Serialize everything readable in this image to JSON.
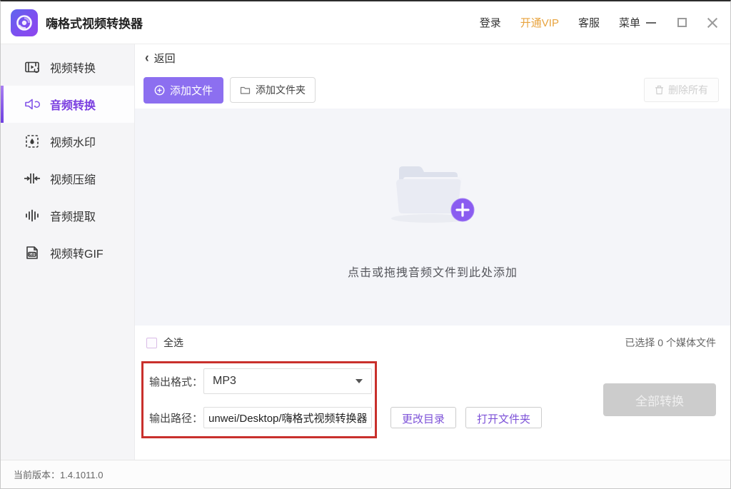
{
  "app": {
    "title": "嗨格式视频转换器",
    "version_text": "当前版本：1.4.1011.0"
  },
  "titlebar": {
    "login": "登录",
    "vip": "开通VIP",
    "support": "客服",
    "menu": "菜单"
  },
  "sidebar": {
    "items": [
      {
        "label": "视频转换",
        "icon": "video-convert-icon",
        "active": false
      },
      {
        "label": "音频转换",
        "icon": "audio-convert-icon",
        "active": true
      },
      {
        "label": "视频水印",
        "icon": "video-watermark-icon",
        "active": false
      },
      {
        "label": "视频压缩",
        "icon": "video-compress-icon",
        "active": false
      },
      {
        "label": "音频提取",
        "icon": "audio-extract-icon",
        "active": false
      },
      {
        "label": "视频转GIF",
        "icon": "video-to-gif-icon",
        "active": false
      }
    ]
  },
  "toolbar": {
    "back": "返回",
    "add_file": "添加文件",
    "add_folder": "添加文件夹",
    "delete_all": "删除所有"
  },
  "dropzone": {
    "hint": "点击或拖拽音频文件到此处添加"
  },
  "selection": {
    "select_all": "全选",
    "selected_count_text": "已选择 0 个媒体文件"
  },
  "output": {
    "format_label": "输出格式：",
    "format_value": "MP3",
    "path_label": "输出路径：",
    "path_value": "unwei/Desktop/嗨格式视频转换器",
    "change_dir": "更改目录",
    "open_folder": "打开文件夹",
    "convert_all": "全部转换"
  },
  "colors": {
    "accent_purple": "#8c6ff0",
    "active_text_purple": "#7b3fe0",
    "vip_orange": "#e8a33d",
    "highlight_red": "#c9302c",
    "disabled_gray": "#cccccc",
    "dropzone_bg": "#f4f5f9"
  }
}
